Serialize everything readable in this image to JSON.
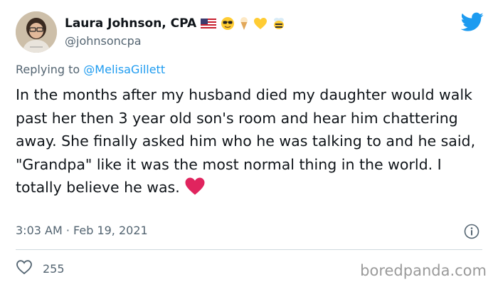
{
  "author": {
    "name": "Laura Johnson, CPA",
    "handle": "@johnsoncpa",
    "name_emojis": [
      "us-flag",
      "sunglasses-face",
      "ice-cream",
      "yellow-heart",
      "bee"
    ]
  },
  "reply": {
    "prefix": "Replying to",
    "mention": "@MelisaGillett"
  },
  "tweet": {
    "text": "In the months after my husband died my daughter would walk past her then 3 year old son's room and hear him chattering away. She finally asked him who he was talking to and he said, \"Grandpa\" like it was the most normal thing in the world. I totally believe he was.",
    "trailing_emoji": "red-heart",
    "timestamp": "3:03 AM · Feb 19, 2021"
  },
  "actions": {
    "like_count": "255"
  },
  "watermark": "boredpanda.com",
  "icons": {
    "logo": "twitter-bird-icon",
    "info": "info-icon",
    "like": "heart-outline-icon"
  },
  "colors": {
    "twitter_blue": "#1d9bf0",
    "text_primary": "#0f1419",
    "text_secondary": "#536471",
    "divider": "#cfd9de",
    "heart_red": "#e0245e"
  }
}
